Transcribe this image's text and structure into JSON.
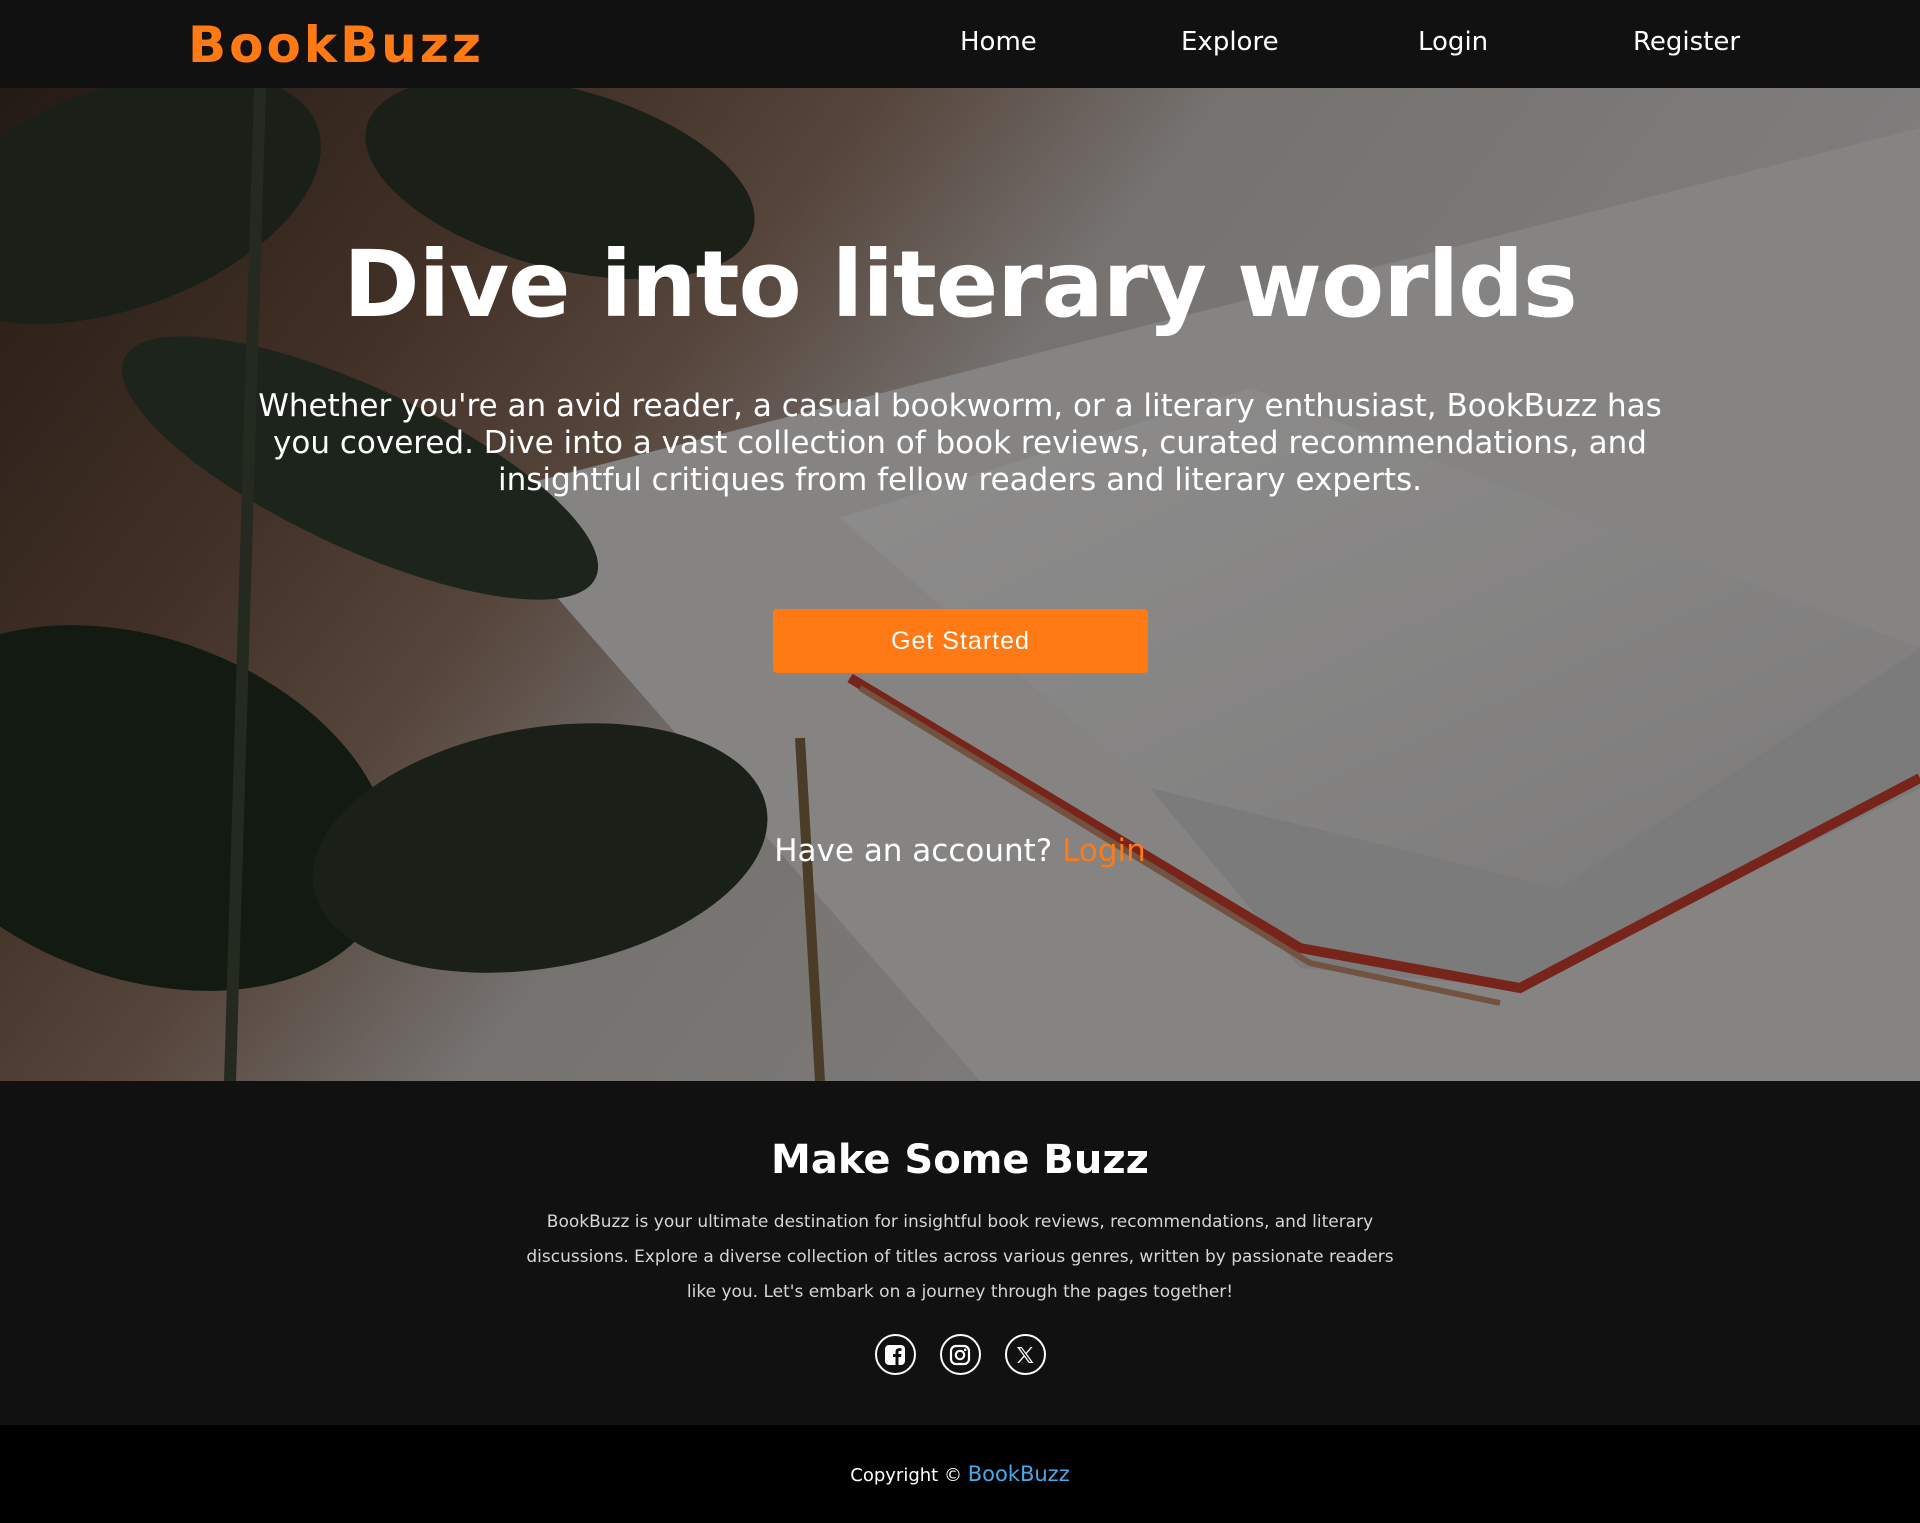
{
  "nav": {
    "brand": "BookBuzz",
    "links": [
      "Home",
      "Explore",
      "Login",
      "Register"
    ]
  },
  "hero": {
    "title": "Dive into literary worlds",
    "description": "Whether you're an avid reader, a casual bookworm, or a literary enthusiast, BookBuzz has you covered. Dive into a vast collection of book reviews, curated recommendations, and insightful critiques from fellow readers and literary experts.",
    "cta_label": "Get Started",
    "account_prompt": "Have an account?",
    "account_link": "Login"
  },
  "about": {
    "title": "Make Some Buzz",
    "text": "BookBuzz is your ultimate destination for insightful book reviews, recommendations, and literary discussions. Explore a diverse collection of titles across various genres, written by passionate readers like you. Let's embark on a journey through the pages together!",
    "socials": [
      "facebook-icon",
      "instagram-icon",
      "x-icon"
    ]
  },
  "footer": {
    "copyright_label": "Copyright ©",
    "owner": "BookBuzz"
  },
  "colors": {
    "accent": "#ff7a14",
    "link_blue": "#4aa8e8",
    "dark_bg": "#111111"
  }
}
